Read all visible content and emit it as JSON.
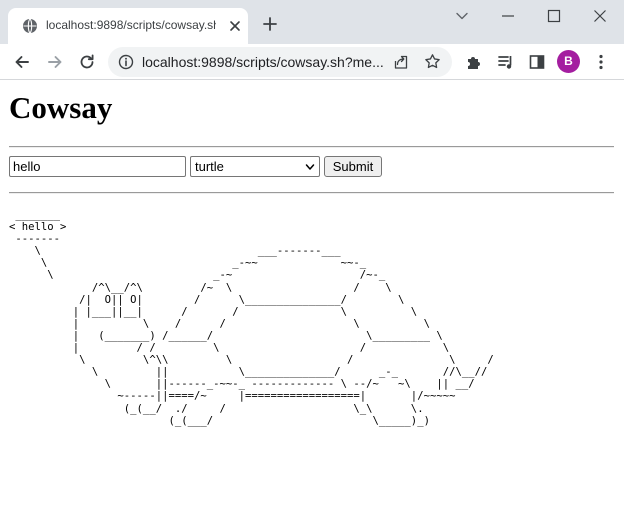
{
  "browser": {
    "tab": {
      "title": "localhost:9898/scripts/cowsay.sh"
    },
    "omnibox": {
      "url": "localhost:9898/scripts/cowsay.sh?me..."
    },
    "profile": {
      "initial": "B",
      "color": "#a41ea0"
    },
    "icons": {
      "tab_favicon": "globe-icon",
      "tab_close": "close-icon",
      "new_tab": "plus-icon",
      "back": "back-arrow-icon",
      "forward": "forward-arrow-icon",
      "reload": "reload-icon",
      "site_info": "info-icon",
      "share": "share-icon",
      "bookmark": "star-icon",
      "extensions": "puzzle-icon",
      "media": "media-queue-icon",
      "side_panel": "side-panel-icon",
      "menu": "kebab-menu-icon"
    }
  },
  "page": {
    "title": "Cowsay",
    "form": {
      "message_value": "hello",
      "cow_selected": "turtle",
      "submit_label": "Submit"
    },
    "output": " _______\n< hello >\n -------\n    \\                                  ___-------___\n     \\                             _-~~             ~~-_\n      \\                         _-~                    /~-_\n             /^\\__/^\\         /~  \\                   /    \\\n           /|  O|| O|        /      \\_______________/        \\\n          | |___||__|      /       /                \\          \\\n          |          \\    /      /                    \\          \\\n          |   (_______) /______/                        \\_________ \\\n          |         / /         \\                      /            \\\n           \\         \\^\\\\         \\                  /               \\     /\n             \\         ||           \\______________/      _-_       //\\__//\n               \\       ||------_-~~-_ ------------- \\ --/~   ~\\    || __/\n                 ~-----||====/~     |==================|       |/~~~~~\n                  (_(__/  ./     /                    \\_\\      \\.\n                         (_(___/                         \\_____)_)"
  }
}
